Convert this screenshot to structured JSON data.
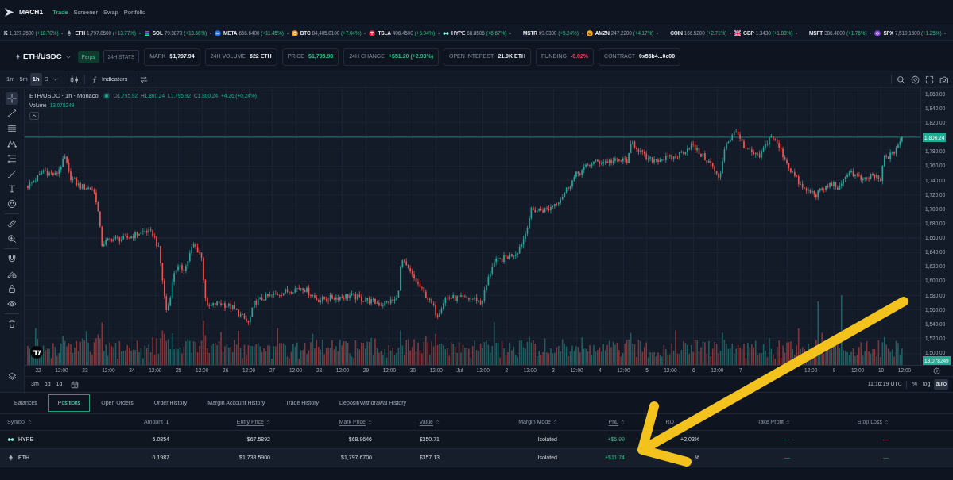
{
  "nav": {
    "brand": "MACH1",
    "links": [
      {
        "label": "Trade",
        "selected": true
      },
      {
        "label": "Screener",
        "selected": false
      },
      {
        "label": "Swap",
        "selected": false
      },
      {
        "label": "Portfolio",
        "selected": false
      }
    ]
  },
  "ticker": [
    {
      "kind": "none",
      "symbol": "K",
      "price": "1,827.2500",
      "change": "(+18.70%)"
    },
    {
      "kind": "diamond",
      "symbol": "ETH",
      "price": "1,797.8500",
      "change": "(+13.77%)"
    },
    {
      "kind": "stripes",
      "symbol": "SOL",
      "price": "79.3870",
      "change": "(+13.66%)"
    },
    {
      "kind": "infinity",
      "symbol": "META",
      "price": "656.6400",
      "change": "(+11.45%)"
    },
    {
      "kind": "coin",
      "symbol": "BTC",
      "price": "84,405.8100",
      "change": "(+7.04%)"
    },
    {
      "kind": "emblem",
      "symbol": "TSLA",
      "price": "406.4500",
      "change": "(+6.94%)"
    },
    {
      "kind": "loop",
      "symbol": "HYPE",
      "price": "68.8506",
      "change": "(+6.67%)"
    },
    {
      "kind": "none",
      "symbol": "MSTR",
      "price": "99.0300",
      "change": "(+5.24%)"
    },
    {
      "kind": "smile",
      "symbol": "AMZN",
      "price": "247.2200",
      "change": "(+4.17%)"
    },
    {
      "kind": "none",
      "symbol": "COIN",
      "price": "166.5200",
      "change": "(+2.71%)"
    },
    {
      "kind": "flag",
      "symbol": "GBP",
      "price": "1.3430",
      "change": "(+1.88%)"
    },
    {
      "kind": "none",
      "symbol": "MSFT",
      "price": "386.4800",
      "change": "(+1.76%)"
    },
    {
      "kind": "ring",
      "symbol": "SPX",
      "price": "7,519.1500",
      "change": "(+1.25%)"
    }
  ],
  "market": {
    "pair": "ETH/USDC",
    "badge": "Perps",
    "stats_button": "24H STATS",
    "stats": [
      {
        "label": "MARK",
        "value": "$1,797.94",
        "kind": "plain"
      },
      {
        "label": "24H VOLUME",
        "value": "622 ETH",
        "kind": "plain"
      },
      {
        "label": "PRICE",
        "value": "$1,795.98",
        "kind": "up"
      },
      {
        "label": "24H CHANGE",
        "value": "+$51.20 (+2.93%)",
        "kind": "up"
      },
      {
        "label": "OPEN INTEREST",
        "value": "21.9K ETH",
        "kind": "plain"
      },
      {
        "label": "FUNDING",
        "value": "-0.02%",
        "kind": "down"
      },
      {
        "label": "CONTRACT",
        "value": "0x56b4...0c00",
        "kind": "plain"
      }
    ]
  },
  "chart": {
    "intervals": [
      {
        "label": "1m",
        "selected": false
      },
      {
        "label": "5m",
        "selected": false
      },
      {
        "label": "1h",
        "selected": true
      },
      {
        "label": "D",
        "selected": false
      }
    ],
    "indicators": "Indicators",
    "tools": [
      {
        "selected": true
      },
      {
        "selected": false
      },
      {
        "selected": false
      },
      {
        "selected": false
      },
      {
        "selected": false
      },
      {
        "selected": false
      },
      {
        "selected": false
      },
      {
        "selected": false
      },
      {
        "selected": false
      },
      {
        "selected": false
      },
      {
        "selected": false
      },
      {
        "selected": false
      },
      {
        "selected": false
      },
      {
        "selected": false
      },
      {
        "selected": false
      }
    ],
    "legend": {
      "title": "ETH/USDC · 1h · Monaco",
      "live": true,
      "ohlc": [
        {
          "label": "O",
          "value": "1,795.92"
        },
        {
          "label": "H",
          "value": "1,800.24"
        },
        {
          "label": "L",
          "value": "1,795.92"
        },
        {
          "label": "C",
          "value": "1,800.24"
        }
      ],
      "change": "+4.26 (+0.24%)",
      "volume_label": "Volume",
      "volume_value": "13.078249"
    },
    "price_axis": [
      {
        "kind": "tick",
        "label": "1,860.00"
      },
      {
        "kind": "tick",
        "label": "1,840.00"
      },
      {
        "kind": "tick",
        "label": "1,820.00"
      },
      {
        "kind": "last",
        "label": "1,800.24"
      },
      {
        "kind": "tick",
        "label": "1,780.00"
      },
      {
        "kind": "tick",
        "label": "1,760.00"
      },
      {
        "kind": "tick",
        "label": "1,740.00"
      },
      {
        "kind": "tick",
        "label": "1,720.00"
      },
      {
        "kind": "tick",
        "label": "1,700.00"
      },
      {
        "kind": "tick",
        "label": "1,680.00"
      },
      {
        "kind": "tick",
        "label": "1,660.00"
      },
      {
        "kind": "tick",
        "label": "1,640.00"
      },
      {
        "kind": "tick",
        "label": "1,620.00"
      },
      {
        "kind": "tick",
        "label": "1,600.00"
      },
      {
        "kind": "tick",
        "label": "1,580.00"
      },
      {
        "kind": "tick",
        "label": "1,560.00"
      },
      {
        "kind": "tick",
        "label": "1,540.00"
      },
      {
        "kind": "tick",
        "label": "1,520.00"
      },
      {
        "kind": "tick",
        "label": "1,500.00"
      }
    ],
    "volume_badge": "13.078249",
    "time_labels": [
      "22",
      "12:00",
      "23",
      "12:00",
      "24",
      "12:00",
      "25",
      "12:00",
      "26",
      "12:00",
      "27",
      "12:00",
      "28",
      "12:00",
      "29",
      "12:00",
      "30",
      "12:00",
      "Jul",
      "12:00",
      "2",
      "12:00",
      "3",
      "12:00",
      "4",
      "12:00",
      "5",
      "12:00",
      "6",
      "12:00",
      "7",
      "12:00",
      "9",
      "12:00",
      "10",
      "12:00"
    ],
    "ranges": [
      "3m",
      "5d",
      "1d"
    ],
    "clock": "11:16:19 UTC",
    "scale_options": [
      {
        "label": "%",
        "selected": false
      },
      {
        "label": "log",
        "selected": false
      },
      {
        "label": "auto",
        "selected": true
      }
    ]
  },
  "tabs": [
    {
      "label": "Balances",
      "selected": false
    },
    {
      "label": "Positions",
      "selected": true
    },
    {
      "label": "Open Orders",
      "selected": false
    },
    {
      "label": "Order History",
      "selected": false
    },
    {
      "label": "Margin Account History",
      "selected": false
    },
    {
      "label": "Trade History",
      "selected": false
    },
    {
      "label": "Deposit/Withdrawal History",
      "selected": false
    }
  ],
  "positions": {
    "columns": [
      {
        "label": "Symbol",
        "sortable": true,
        "sort_descending": false,
        "underlined": false,
        "kind": "symbol"
      },
      {
        "label": "Amount",
        "sortable": true,
        "sort_descending": true,
        "underlined": false,
        "kind": "number"
      },
      {
        "label": "Entry Price",
        "sortable": true,
        "sort_descending": false,
        "underlined": true,
        "kind": "number"
      },
      {
        "label": "Mark Price",
        "sortable": true,
        "sort_descending": false,
        "underlined": true,
        "kind": "number"
      },
      {
        "label": "Value",
        "sortable": true,
        "sort_descending": false,
        "underlined": true,
        "kind": "number"
      },
      {
        "label": "Margin Mode",
        "sortable": true,
        "sort_descending": false,
        "underlined": false,
        "kind": "number"
      },
      {
        "label": "PnL",
        "sortable": true,
        "sort_descending": false,
        "underlined": true,
        "kind": "gain"
      },
      {
        "label": "RO",
        "sortable": false,
        "sort_descending": false,
        "underlined": false,
        "kind": "number"
      },
      {
        "label": "Take Profit",
        "sortable": true,
        "sort_descending": false,
        "underlined": false,
        "kind": "gain"
      },
      {
        "label": "Stop Loss",
        "sortable": true,
        "sort_descending": false,
        "underlined": false,
        "kind": "loss"
      }
    ],
    "rows": [
      {
        "kind": "loop",
        "cells": [
          "HYPE",
          "5.0854",
          "$67.5892",
          "$68.9646",
          "$350.71",
          "Isolated",
          "+$6.99",
          "+2.03%",
          "—",
          "—"
        ]
      },
      {
        "kind": "diamond",
        "cells": [
          "ETH",
          "0.1987",
          "$1,738.5900",
          "$1,797.6700",
          "$357.13",
          "Isolated",
          "+$11.74",
          "%",
          "—",
          "—"
        ]
      }
    ]
  },
  "annotation": {
    "kind": "arrow"
  }
}
